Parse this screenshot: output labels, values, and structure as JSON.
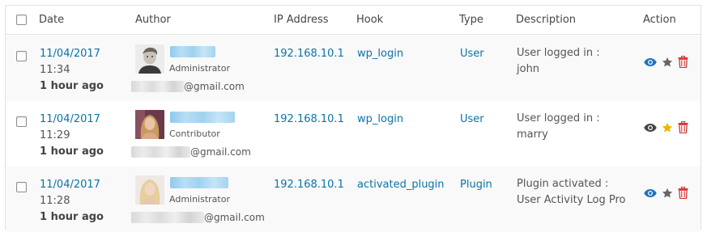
{
  "headers": {
    "date": "Date",
    "author": "Author",
    "ip": "IP Address",
    "hook": "Hook",
    "type": "Type",
    "description": "Description",
    "action": "Action"
  },
  "rows": [
    {
      "date": "11/04/2017",
      "time": "11:34",
      "ago": "1 hour ago",
      "role": "Administrator",
      "email_domain": "@gmail.com",
      "ip": "192.168.10.1",
      "hook": "wp_login",
      "type": "User",
      "desc_line1": "User logged in :",
      "desc_line2": "john",
      "starred": false
    },
    {
      "date": "11/04/2017",
      "time": "11:29",
      "ago": "1 hour ago",
      "role": "Contributor",
      "email_domain": "@gmail.com",
      "ip": "192.168.10.1",
      "hook": "wp_login",
      "type": "User",
      "desc_line1": "User logged in :",
      "desc_line2": "marry",
      "starred": true
    },
    {
      "date": "11/04/2017",
      "time": "11:28",
      "ago": "1 hour ago",
      "role": "Administrator",
      "email_domain": "@gmail.com",
      "ip": "192.168.10.1",
      "hook": "activated_plugin",
      "type": "Plugin",
      "desc_line1": "Plugin activated :",
      "desc_line2": "User Activity Log Pro",
      "starred": false
    }
  ],
  "colors": {
    "link": "#0a73a8",
    "view_icon_row1": "#1e73be",
    "view_icon_row2": "#444444",
    "star_inactive": "#666666",
    "star_active": "#f0b400",
    "trash": "#d63638"
  }
}
